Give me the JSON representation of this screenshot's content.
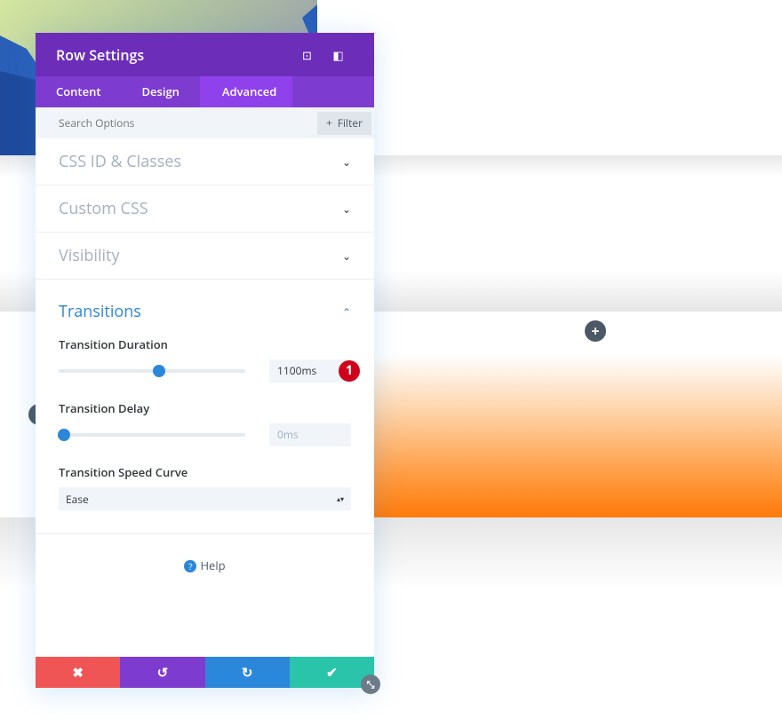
{
  "panel": {
    "title": "Row Settings",
    "header_icons": [
      "focus-icon",
      "sidebar-layout-icon"
    ],
    "tabs": [
      {
        "label": "Content"
      },
      {
        "label": "Design"
      },
      {
        "label": "Advanced",
        "active": true
      }
    ],
    "search": {
      "placeholder": "Search Options",
      "filter_label": "Filter"
    },
    "groups": [
      {
        "label": "CSS ID & Classes"
      },
      {
        "label": "Custom CSS"
      },
      {
        "label": "Visibility"
      }
    ],
    "transitions": {
      "label": "Transitions",
      "duration": {
        "label": "Transition Duration",
        "value": "1100ms",
        "slider_fraction": 0.54,
        "badge": "1"
      },
      "delay": {
        "label": "Transition Delay",
        "value": "0ms",
        "slider_fraction": 0
      },
      "curve": {
        "label": "Transition Speed Curve",
        "value": "Ease"
      }
    },
    "help": "Help",
    "footer": {
      "colors": {
        "cancel": "#ef5555",
        "undo": "#7e3bd0",
        "redo": "#2b87da",
        "save": "#29c4a9"
      }
    }
  },
  "colors": {
    "header": "#6c2eb9",
    "tabs": "#7e3bd0",
    "active_tab": "#8f42ec",
    "accent": "#2b87da",
    "badge": "#d0021b"
  }
}
